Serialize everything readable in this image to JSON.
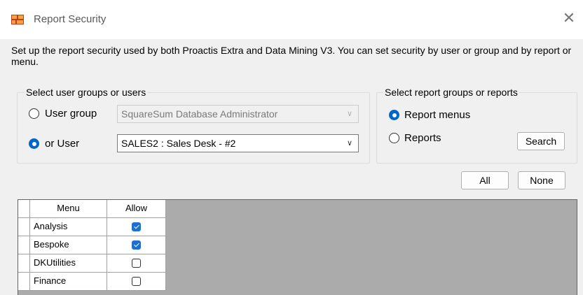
{
  "window": {
    "title": "Report Security",
    "close_glyph": "✕"
  },
  "description": "Set up the report security used by both Proactis Extra and Data Mining V3. You can set security by user or group and by report or menu.",
  "user_box": {
    "label": "Select user groups or users",
    "group_option_label": "User group",
    "group_option_selected": false,
    "group_value": "SquareSum Database Administrator",
    "user_option_label": "or User",
    "user_option_selected": true,
    "user_value": "SALES2 : Sales Desk - #2"
  },
  "report_box": {
    "label": "Select report groups or reports",
    "menus_option_label": "Report menus",
    "menus_option_selected": true,
    "reports_option_label": "Reports",
    "reports_option_selected": false,
    "search_label": "Search"
  },
  "buttons": {
    "all_label": "All",
    "none_label": "None"
  },
  "grid": {
    "columns": [
      "Menu",
      "Allow"
    ],
    "rows": [
      {
        "menu": "Analysis",
        "allow": true
      },
      {
        "menu": "Bespoke",
        "allow": true
      },
      {
        "menu": "DKUtilities",
        "allow": false
      },
      {
        "menu": "Finance",
        "allow": false
      }
    ]
  },
  "icons": {
    "app": "security-shield-icon",
    "close": "close-icon",
    "dropdown": "chevron-down-icon"
  }
}
